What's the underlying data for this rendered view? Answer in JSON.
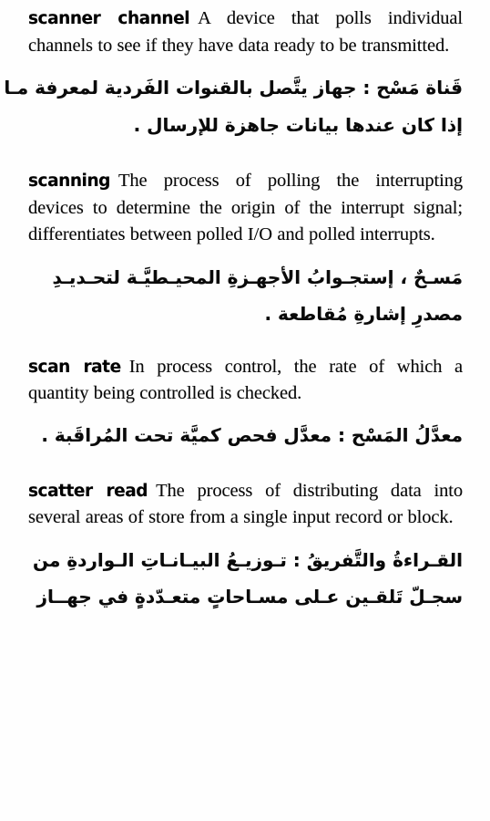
{
  "page": {
    "kind": "bilingual-dictionary-page",
    "language_primary": "English",
    "language_secondary": "Arabic",
    "background_color": "#fefefe",
    "text_color": "#0a0a0a"
  },
  "entries": [
    {
      "id": "scanner-channel",
      "headword": "scanner channel",
      "definition_en": "A device that polls individual channels to see if they have data ready to be transmitted.",
      "definition_ar_lines": [
        "قَناة مَسْح : جهاز يتَّصل بالقنوات الفَردية لمعرفة مـا",
        "إذا كان عندها بيانات جاهزة للإرسال ."
      ]
    },
    {
      "id": "scanning",
      "headword": "scanning",
      "definition_en": "The process of polling the interrupting devices to determine the origin of the interrupt signal; differentiates between polled I/O and polled interrupts.",
      "definition_ar_lines": [
        "مَسـحٌ ، إستجـوابُ الأجهـزةِ المحيـطيَّـة لتحـديـدِ",
        "مصدرِ إشارةِ مُقاطعة ."
      ]
    },
    {
      "id": "scan-rate",
      "headword": "scan rate",
      "definition_en": "In process control, the rate of which a quantity being controlled is checked.",
      "definition_ar_lines": [
        "معدَّلُ المَسْح : معدَّل فحص كميَّة تحت المُراقَبة ."
      ]
    },
    {
      "id": "scatter-read",
      "headword": "scatter read",
      "definition_en": "The process of distributing data into several areas of store from a single input record or block.",
      "definition_ar_lines": [
        "القـراءةُ والتَّفريقُ : تـوزيـعُ البيـانـاتِ الـواردةِ من",
        "سجـلّ تَلقـين عـلى مسـاحاتٍ متعـدّدةٍ في جهــاز"
      ]
    }
  ]
}
